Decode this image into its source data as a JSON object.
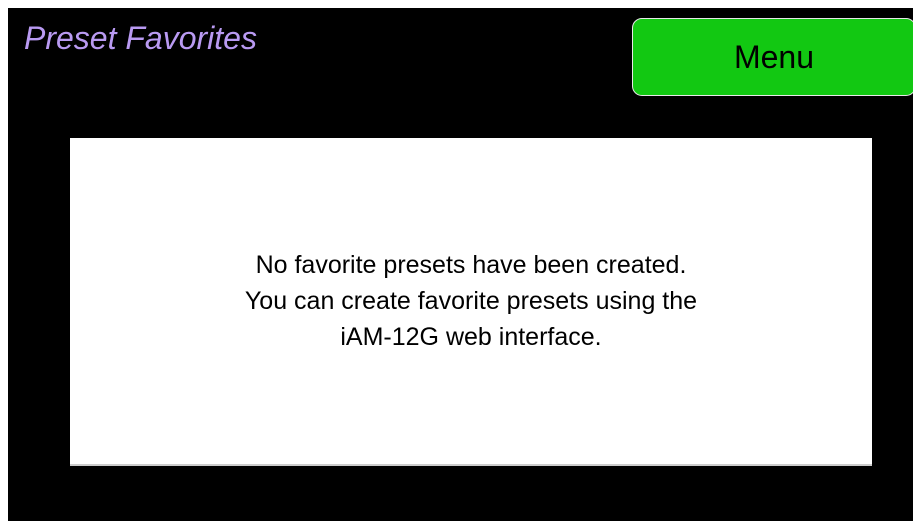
{
  "screen": {
    "title": "Preset Favorites",
    "title_color": "#b99af2"
  },
  "menu_button": {
    "label": "Menu",
    "color": "#12c812"
  },
  "message": {
    "lines": [
      "No favorite presets have been created.",
      "You can create favorite presets using the",
      "iAM-12G web interface."
    ]
  }
}
